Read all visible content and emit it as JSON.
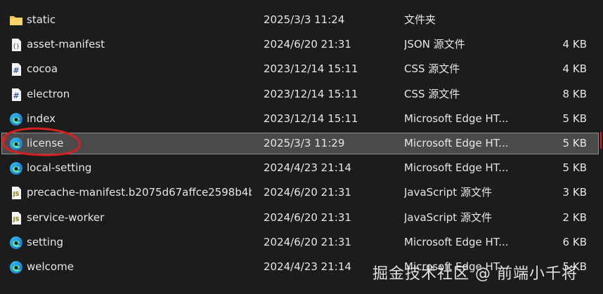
{
  "files": [
    {
      "name": "static",
      "date": "2025/3/3 11:24",
      "type": "文件夹",
      "size": "",
      "icon": "folder-icon"
    },
    {
      "name": "asset-manifest",
      "date": "2024/6/20 21:31",
      "type": "JSON 源文件",
      "size": "4 KB",
      "icon": "json-file-icon"
    },
    {
      "name": "cocoa",
      "date": "2023/12/14 15:11",
      "type": "CSS 源文件",
      "size": "4 KB",
      "icon": "css-file-icon"
    },
    {
      "name": "electron",
      "date": "2023/12/14 15:11",
      "type": "CSS 源文件",
      "size": "8 KB",
      "icon": "css-file-icon"
    },
    {
      "name": "index",
      "date": "2023/12/14 15:11",
      "type": "Microsoft Edge HT...",
      "size": "5 KB",
      "icon": "edge-html-icon"
    },
    {
      "name": "license",
      "date": "2025/3/3 11:29",
      "type": "Microsoft Edge HT...",
      "size": "5 KB",
      "icon": "edge-html-icon",
      "selected": true
    },
    {
      "name": "local-setting",
      "date": "2024/4/23 21:14",
      "type": "Microsoft Edge HT...",
      "size": "5 KB",
      "icon": "edge-html-icon"
    },
    {
      "name": "precache-manifest.b2075d67affce2598b4b...",
      "date": "2024/6/20 21:31",
      "type": "JavaScript 源文件",
      "size": "3 KB",
      "icon": "js-file-icon"
    },
    {
      "name": "service-worker",
      "date": "2024/6/20 21:31",
      "type": "JavaScript 源文件",
      "size": "2 KB",
      "icon": "js-file-icon"
    },
    {
      "name": "setting",
      "date": "2024/6/20 21:31",
      "type": "Microsoft Edge HT...",
      "size": "6 KB",
      "icon": "edge-html-icon"
    },
    {
      "name": "welcome",
      "date": "2024/4/23 21:14",
      "type": "Microsoft Edge HT...",
      "size": "5 KB",
      "icon": "edge-html-icon"
    }
  ],
  "watermark": "掘金技术社区 @ 前端小千将",
  "colors": {
    "background": "#1c1c1c",
    "text": "#e6e6e6",
    "selection": "#4a4a4a",
    "annotation": "#d32020",
    "folder": "#f2c14e"
  }
}
